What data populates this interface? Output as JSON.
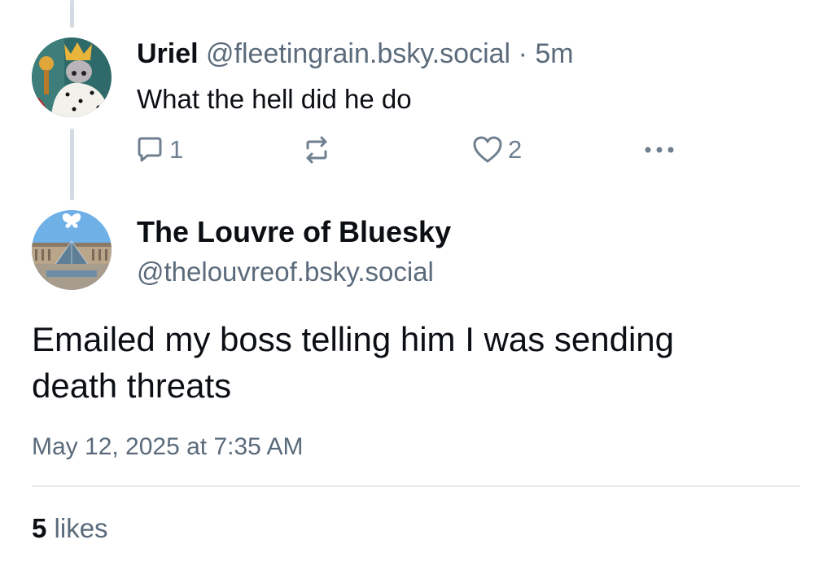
{
  "reply_post": {
    "author_name": "Uriel",
    "author_handle": "@fleetingrain.bsky.social",
    "separator": "·",
    "time_ago": "5m",
    "text": "What the hell did he do",
    "reply_count": "1",
    "repost_count": "",
    "like_count": "2",
    "avatar_icon": "crowned-cartoon-rabbit-avatar"
  },
  "main_post": {
    "author_name": "The Louvre of Bluesky",
    "author_handle": "@thelouvreof.bsky.social",
    "text_line1": "Emailed my boss telling him I was sending",
    "text_line2": "death threats",
    "timestamp": "May 12, 2025 at 7:35 AM",
    "likes_count": "5",
    "likes_label": "likes",
    "avatar_icon": "louvre-pyramid-butterfly-avatar"
  },
  "icons": {
    "reply": "comment-icon",
    "repost": "repost-icon",
    "like": "heart-icon",
    "more": "ellipsis-icon"
  },
  "colors": {
    "text_primary": "#0b0f14",
    "text_secondary": "#5b6b7b",
    "icon_gray": "#6f7f8f",
    "thread_line": "#d4dbe2",
    "divider": "#e6eaee"
  }
}
